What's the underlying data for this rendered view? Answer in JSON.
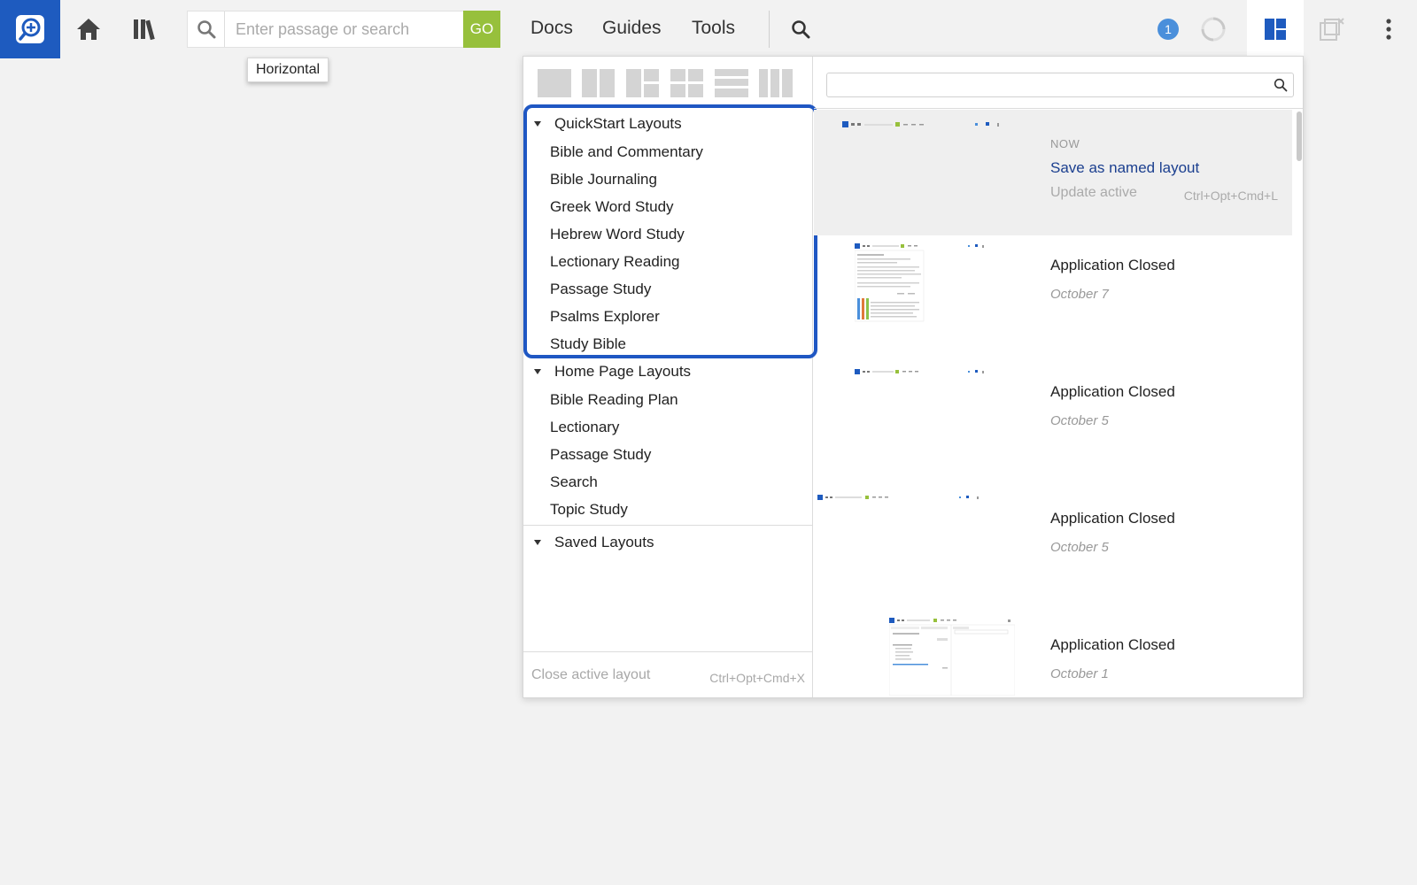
{
  "toolbar": {
    "search_placeholder": "Enter passage or search",
    "go_label": "GO",
    "nav": [
      "Docs",
      "Guides",
      "Tools"
    ],
    "notification_count": "1",
    "brand_color": "#1e5bbf",
    "go_color": "#97c03c"
  },
  "tooltip": "Horizontal",
  "layouts_panel": {
    "groups": [
      {
        "title": "QuickStart Layouts",
        "items": [
          "Bible and Commentary",
          "Bible Journaling",
          "Greek Word Study",
          "Hebrew Word Study",
          "Lectionary Reading",
          "Passage Study",
          "Psalms Explorer",
          "Study Bible"
        ]
      },
      {
        "title": "Home Page Layouts",
        "items": [
          "Bible Reading Plan",
          "Lectionary",
          "Passage Study",
          "Search",
          "Topic Study"
        ]
      },
      {
        "title": "Saved Layouts",
        "items": []
      }
    ],
    "close_active": "Close active layout",
    "close_active_shortcut": "Ctrl+Opt+Cmd+X",
    "current": {
      "label": "NOW",
      "save_named": "Save as named layout",
      "update_active": "Update active",
      "update_shortcut": "Ctrl+Opt+Cmd+L"
    },
    "history": [
      {
        "title": "Application Closed",
        "date": "October 7"
      },
      {
        "title": "Application Closed",
        "date": "October 5"
      },
      {
        "title": "Application Closed",
        "date": "October 5"
      },
      {
        "title": "Application Closed",
        "date": "October 1"
      }
    ],
    "highlight_color": "#1f57c3"
  }
}
